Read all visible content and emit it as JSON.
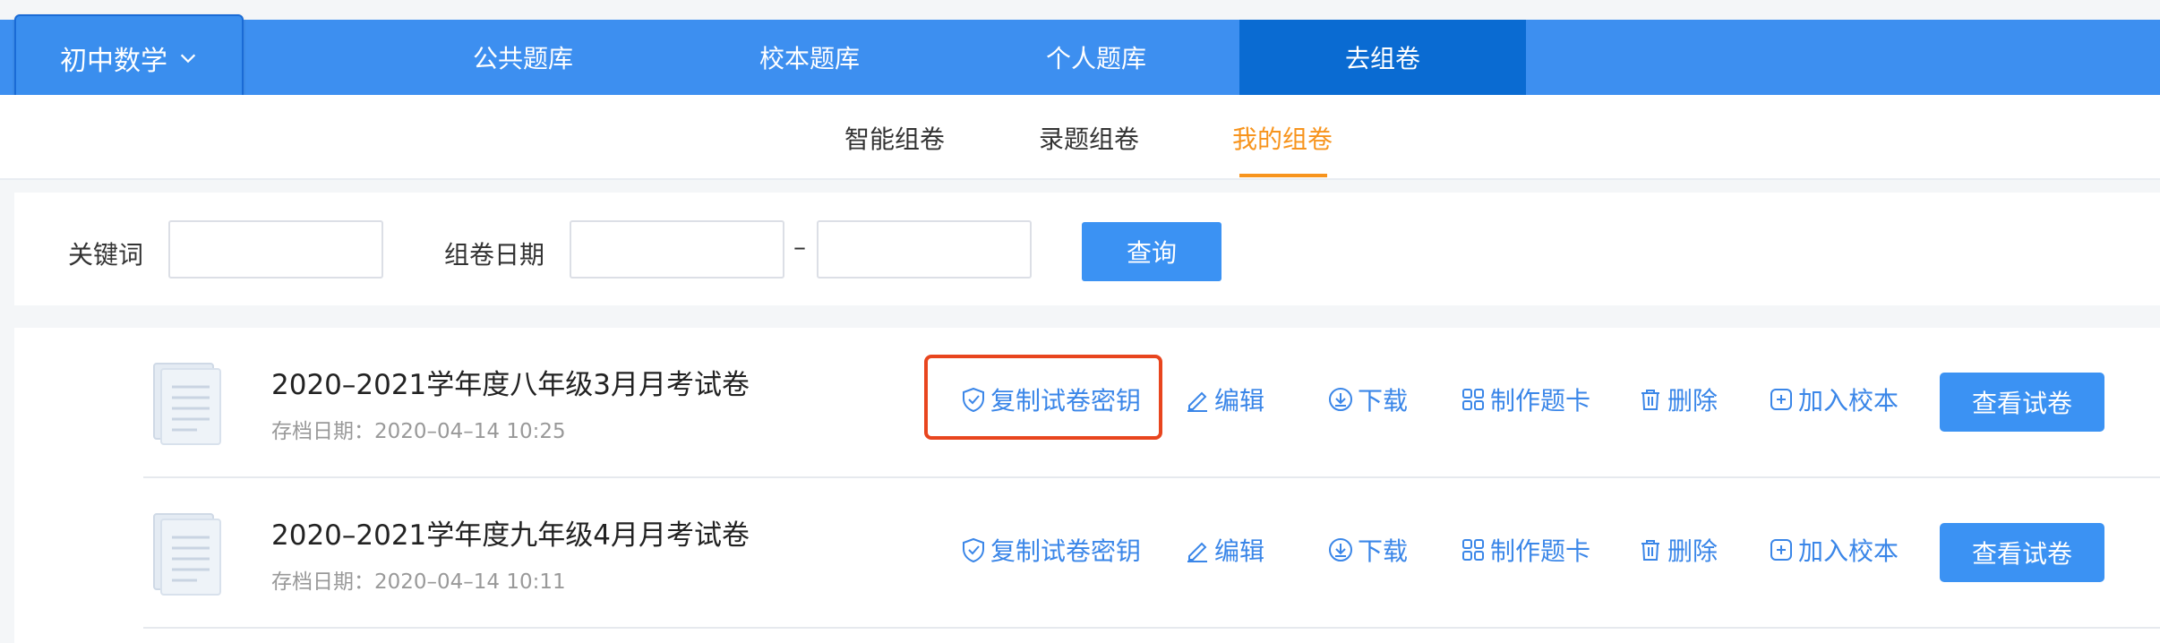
{
  "subject": {
    "label": "初中数学"
  },
  "nav": {
    "items": [
      "公共题库",
      "校本题库",
      "个人题库",
      "去组卷"
    ],
    "active": "去组卷"
  },
  "subnav": {
    "items": [
      "智能组卷",
      "录题组卷",
      "我的组卷"
    ],
    "active": "我的组卷"
  },
  "filter": {
    "keyword_label": "关键词",
    "keyword_value": "",
    "date_label": "组卷日期",
    "date_from": "",
    "date_to": "",
    "separator": "–",
    "query_button": "查询"
  },
  "papers": [
    {
      "title": "2020–2021学年度八年级3月月考试卷",
      "date": "存档日期：2020–04–14 10:25"
    },
    {
      "title": "2020–2021学年度九年级4月月考试卷",
      "date": "存档日期：2020–04–14 10:11"
    }
  ],
  "actions": {
    "copy_key": "复制试卷密钥",
    "edit": "编辑",
    "download": "下载",
    "answer_card": "制作题卡",
    "delete": "删除",
    "add_school": "加入校本",
    "view": "查看试卷"
  },
  "colors": {
    "primary": "#3d8ff0",
    "active_nav": "#0a6bd2",
    "accent": "#f7941d",
    "highlight": "#e8451e"
  }
}
